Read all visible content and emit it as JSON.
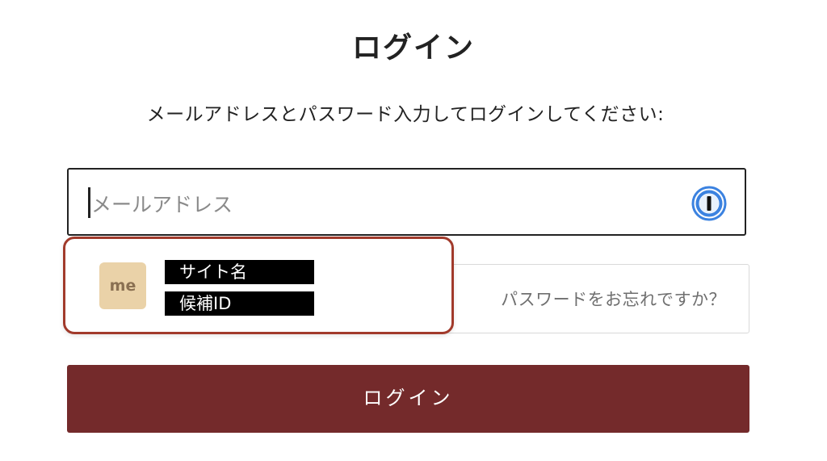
{
  "page": {
    "title": "ログイン",
    "subtitle": "メールアドレスとパスワード入力してログインしてください:"
  },
  "email": {
    "placeholder": "メールアドレス",
    "password_manager_icon": "1password-icon"
  },
  "password": {
    "forgot_link": "パスワードをお忘れですか？"
  },
  "autofill": {
    "avatar_text": "me",
    "site_name": "サイト名",
    "candidate_id": "候補ID"
  },
  "login_button": {
    "label": "ログイン",
    "color": "#742a2b"
  },
  "colors": {
    "highlight_border": "#a13a2b",
    "avatar_bg": "#ead2a8",
    "pm_icon_blue": "#3b82e0"
  }
}
